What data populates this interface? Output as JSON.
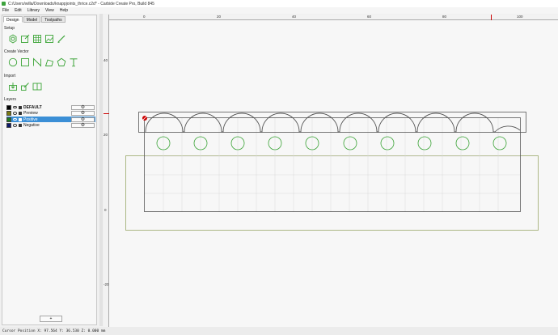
{
  "window": {
    "title": "C:/Users/willa/Downloads/knappjoints_thrice.c2d* - Carbide Create Pro, Build 845"
  },
  "menu": [
    "File",
    "Edit",
    "Library",
    "View",
    "Help"
  ],
  "tabs": [
    "Design",
    "Model",
    "Toolpaths"
  ],
  "sections": {
    "setup": "Setup",
    "create_vector": "Create Vector",
    "import": "Import",
    "layers": "Layers"
  },
  "setup_tools": [
    "gear-icon",
    "edit-icon",
    "grid-icon",
    "image-icon",
    "pen-icon"
  ],
  "vector_tools": [
    "circle-icon",
    "rectangle-icon",
    "curve-icon",
    "polygon-icon",
    "pentagon-icon",
    "text-icon"
  ],
  "import_tools": [
    "import-icon",
    "import-shapes-icon",
    "book-icon"
  ],
  "layers": [
    {
      "name": "DEFAULT",
      "color": "#000000",
      "bold": true,
      "selected": false
    },
    {
      "name": "Preview",
      "color": "#7a7a10",
      "bold": false,
      "selected": false
    },
    {
      "name": "Positive",
      "color": "#1f7a1f",
      "bold": false,
      "selected": true
    },
    {
      "name": "Negative",
      "color": "#0e1a6b",
      "bold": false,
      "selected": false
    }
  ],
  "add_layer_label": "+",
  "ruler": {
    "top_ticks": [
      "0",
      "20",
      "40",
      "60",
      "80",
      "100"
    ],
    "left_ticks": [
      "40",
      "20",
      "0",
      "-20"
    ]
  },
  "colors": {
    "accent": "#3b8fd6",
    "vector": "#3aa336",
    "stock_outline": "#9aa86a",
    "cursor_marker": "#cc0000"
  },
  "status": {
    "cursor": "Cursor Position X: 97.564 Y: 36.530 Z: 0.000 mm"
  }
}
